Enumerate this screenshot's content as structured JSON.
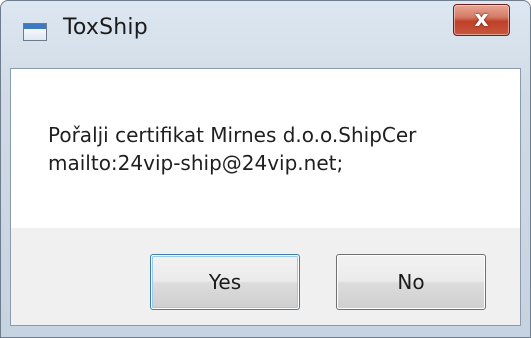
{
  "window": {
    "title": "ToxShip",
    "close_glyph": "x",
    "app_icon": "window-icon"
  },
  "dialog": {
    "message_lines": [
      "Pořalji certifikat Mirnes d.o.o.ShipCer",
      "mailto:24vip-ship@24vip.net;"
    ],
    "buttons": {
      "yes_label": "Yes",
      "no_label": "No"
    }
  },
  "colors": {
    "close_button": "#c8573d",
    "default_button_border": "#3c7fb1",
    "frame": "#c6d3e0"
  }
}
